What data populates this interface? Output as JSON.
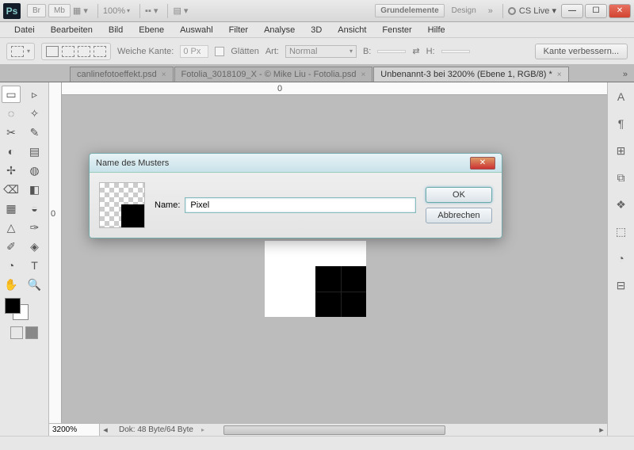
{
  "titlebar": {
    "br": "Br",
    "mb": "Mb",
    "view_dd": "▦ ▾",
    "zoom": "100%",
    "layout": "▪▪ ▾",
    "panel": "▤ ▾",
    "btn1": "Grundelemente",
    "btn2": "Design",
    "chev": "»",
    "cslive": "CS Live ▾"
  },
  "menu": [
    "Datei",
    "Bearbeiten",
    "Bild",
    "Ebene",
    "Auswahl",
    "Filter",
    "Analyse",
    "3D",
    "Ansicht",
    "Fenster",
    "Hilfe"
  ],
  "options": {
    "weiche": "Weiche Kante:",
    "weiche_val": "0 Px",
    "glaetten": "Glätten",
    "art": "Art:",
    "art_val": "Normal",
    "b": "B:",
    "h": "H:",
    "verbessern": "Kante verbessern..."
  },
  "tabs": [
    {
      "label": "canlinefotoeffekt.psd",
      "active": false
    },
    {
      "label": "Fotolia_3018109_X - © Mike Liu - Fotolia.psd",
      "active": false
    },
    {
      "label": "Unbenannt-3 bei 3200% (Ebene 1, RGB/8) *",
      "active": true
    }
  ],
  "tabs_chev": "»",
  "ruler": {
    "h_mark": "0",
    "v_mark": "0"
  },
  "status": {
    "zoom": "3200%",
    "doc": "Dok: 48 Byte/64 Byte"
  },
  "dialog": {
    "title": "Name des Musters",
    "name_label": "Name:",
    "name_value": "Pixel",
    "ok": "OK",
    "cancel": "Abbrechen"
  },
  "tools": [
    "▭",
    "▹",
    "◌",
    "✧",
    "✂",
    "✎",
    "◐",
    "▤",
    "✢",
    "◍",
    "⌫",
    "◧",
    "▦",
    "◒",
    "△",
    "◈",
    "◔",
    "✑",
    "✐",
    "T",
    "↖",
    "▷",
    "✋",
    "🔍"
  ],
  "panels": [
    "A",
    "¶",
    "⊞",
    "⧉",
    "❖",
    "⬚",
    "◔",
    "⊟"
  ]
}
